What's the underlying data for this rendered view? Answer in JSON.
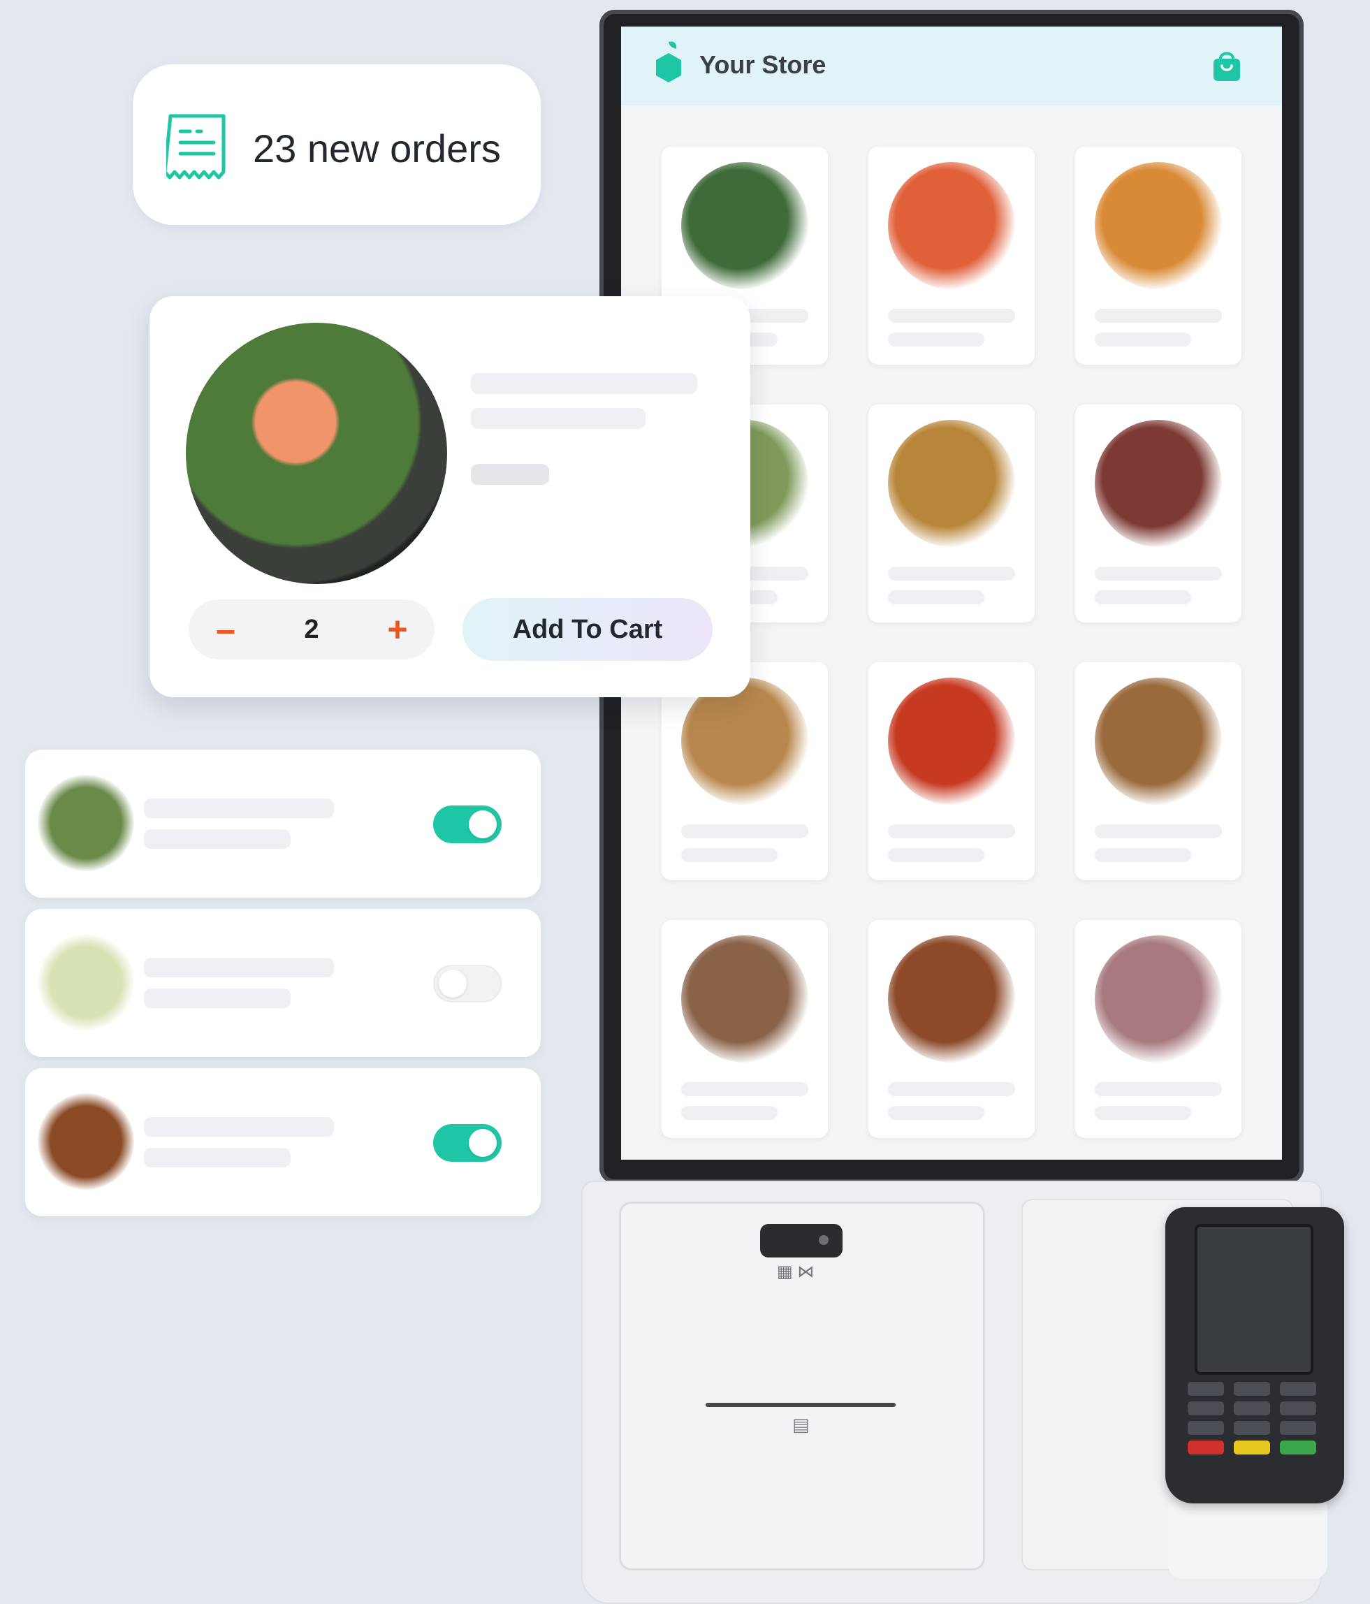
{
  "orders_badge": {
    "text": "23 new orders",
    "icon": "receipt-icon"
  },
  "kiosk": {
    "store_name": "Your Store",
    "header_bg": "#dff3f8",
    "brand_color": "#1fc6a6",
    "cart_icon": "shopping-bag-icon",
    "products": [
      {
        "color": "#3f6b3a"
      },
      {
        "color": "#e0603a"
      },
      {
        "color": "#d98a36"
      },
      {
        "color": "#7f9a5a"
      },
      {
        "color": "#b8863a"
      },
      {
        "color": "#7d3a34"
      },
      {
        "color": "#b8874d"
      },
      {
        "color": "#c63a22"
      },
      {
        "color": "#9a6a3c"
      },
      {
        "color": "#8a6248"
      },
      {
        "color": "#8c4a2a"
      },
      {
        "color": "#a87a80"
      }
    ]
  },
  "product_detail": {
    "quantity": "2",
    "decrement_label": "–",
    "increment_label": "+",
    "add_to_cart_label": "Add To Cart",
    "accent_color": "#f0551d"
  },
  "toggle_items": [
    {
      "enabled": true,
      "color": "#6a8a4a"
    },
    {
      "enabled": false,
      "color": "#d7e3b4"
    },
    {
      "enabled": true,
      "color": "#8a4a26"
    }
  ]
}
